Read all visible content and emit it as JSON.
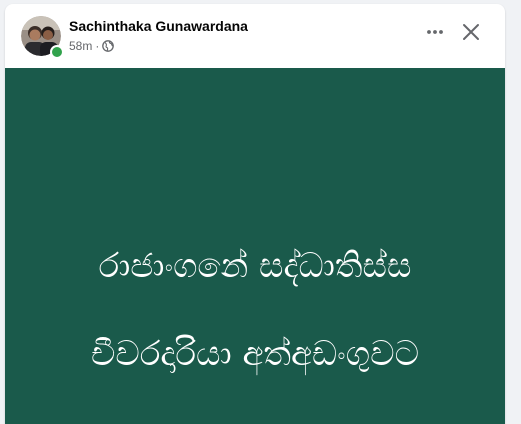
{
  "post": {
    "author": "Sachinthaka Gunawardana",
    "time": "58m",
    "separator": "·",
    "audience_icon": "globe-icon",
    "background_color": "#1a5a4b",
    "text_lines": [
      "රාජාංගනේ සද්ධාතිස්ස",
      "චීවරදාරියා අත්අඩංගුවට"
    ]
  },
  "header_actions": {
    "more_icon": "more-horizontal-icon",
    "close_icon": "close-icon"
  },
  "colors": {
    "online_status": "#31a24c",
    "name_text": "#050505",
    "meta_text": "#65676b"
  }
}
